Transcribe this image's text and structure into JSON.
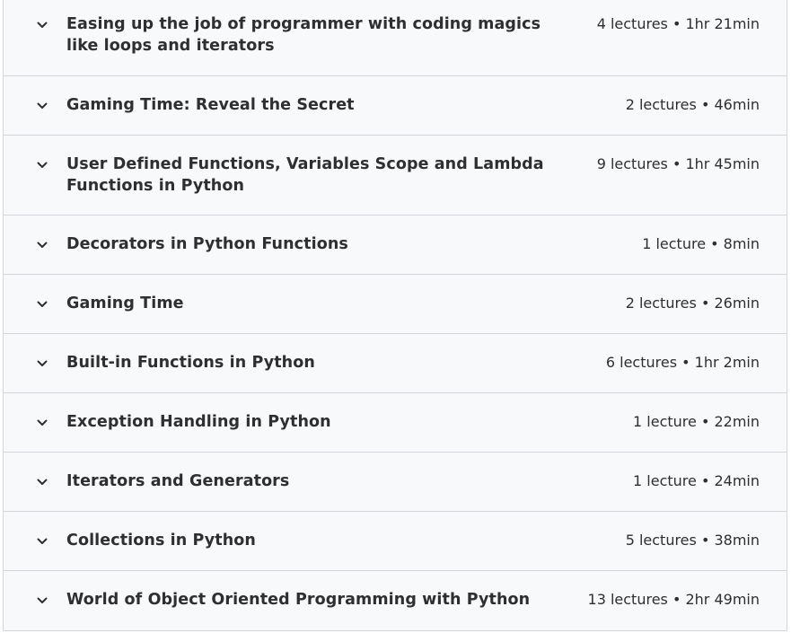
{
  "sections": [
    {
      "title": "Easing up the job of programmer with coding magics like loops and iterators",
      "meta": "4 lectures • 1hr 21min",
      "icon": "chevron-down-icon"
    },
    {
      "title": "Gaming Time: Reveal the Secret",
      "meta": "2 lectures • 46min",
      "icon": "chevron-down-icon"
    },
    {
      "title": "User Defined Functions, Variables Scope and Lambda Functions in Python",
      "meta": "9 lectures • 1hr 45min",
      "icon": "chevron-down-icon"
    },
    {
      "title": "Decorators in Python Functions",
      "meta": "1 lecture • 8min",
      "icon": "chevron-down-icon"
    },
    {
      "title": "Gaming Time",
      "meta": "2 lectures • 26min",
      "icon": "chevron-down-icon"
    },
    {
      "title": "Built-in Functions in Python",
      "meta": "6 lectures • 1hr 2min",
      "icon": "chevron-down-icon"
    },
    {
      "title": "Exception Handling in Python",
      "meta": "1 lecture • 22min",
      "icon": "chevron-down-icon"
    },
    {
      "title": "Iterators and Generators",
      "meta": "1 lecture • 24min",
      "icon": "chevron-down-icon"
    },
    {
      "title": "Collections in Python",
      "meta": "5 lectures • 38min",
      "icon": "chevron-down-icon"
    },
    {
      "title": "World of Object Oriented Programming with Python",
      "meta": "13 lectures • 2hr 49min",
      "icon": "chevron-down-icon"
    }
  ]
}
